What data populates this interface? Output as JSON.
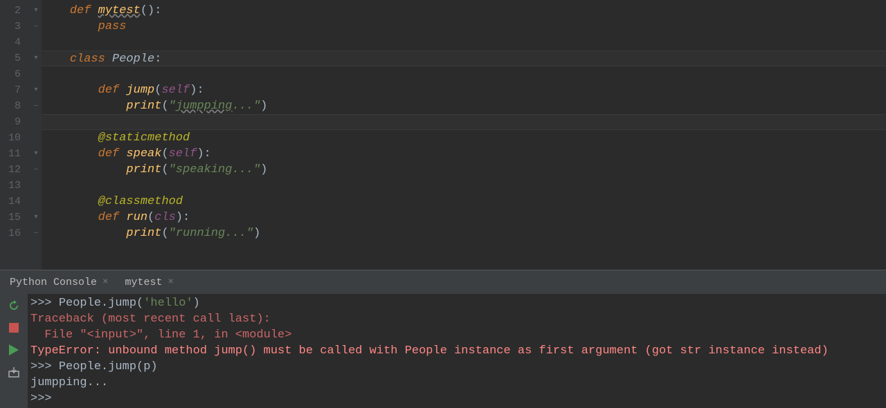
{
  "editor": {
    "lines": [
      {
        "num": 2,
        "fold": "▾",
        "tokens": [
          {
            "t": "kw",
            "v": "def "
          },
          {
            "t": "fn-ul",
            "v": "mytest"
          },
          {
            "t": "punct",
            "v": "():"
          }
        ],
        "indent": 1
      },
      {
        "num": 3,
        "fold": "—",
        "tokens": [
          {
            "t": "kw",
            "v": "pass"
          }
        ],
        "indent": 2
      },
      {
        "num": 4,
        "fold": "",
        "tokens": [],
        "indent": 0
      },
      {
        "num": 5,
        "fold": "▾",
        "tokens": [
          {
            "t": "kw",
            "v": "class "
          },
          {
            "t": "cls",
            "v": "People"
          },
          {
            "t": "punct",
            "v": ":"
          }
        ],
        "indent": 1,
        "hl": true
      },
      {
        "num": 6,
        "fold": "",
        "tokens": [],
        "indent": 0
      },
      {
        "num": 7,
        "fold": "▾",
        "tokens": [
          {
            "t": "kw",
            "v": "def "
          },
          {
            "t": "fn",
            "v": "jump"
          },
          {
            "t": "punct",
            "v": "("
          },
          {
            "t": "self",
            "v": "self"
          },
          {
            "t": "punct",
            "v": "):"
          }
        ],
        "indent": 2
      },
      {
        "num": 8,
        "fold": "—",
        "tokens": [
          {
            "t": "fn",
            "v": "print"
          },
          {
            "t": "punct",
            "v": "("
          },
          {
            "t": "str",
            "v": "\""
          },
          {
            "t": "str-ul",
            "v": "jumpping"
          },
          {
            "t": "str",
            "v": "...\""
          },
          {
            "t": "punct",
            "v": ")"
          }
        ],
        "indent": 3
      },
      {
        "num": 9,
        "fold": "",
        "tokens": [],
        "indent": 0,
        "hl": true
      },
      {
        "num": 10,
        "fold": "",
        "tokens": [
          {
            "t": "deco",
            "v": "@staticmethod"
          }
        ],
        "indent": 2
      },
      {
        "num": 11,
        "fold": "▾",
        "tokens": [
          {
            "t": "kw",
            "v": "def "
          },
          {
            "t": "fn",
            "v": "speak"
          },
          {
            "t": "punct",
            "v": "("
          },
          {
            "t": "self",
            "v": "self"
          },
          {
            "t": "punct",
            "v": "):"
          }
        ],
        "indent": 2
      },
      {
        "num": 12,
        "fold": "—",
        "tokens": [
          {
            "t": "fn",
            "v": "print"
          },
          {
            "t": "punct",
            "v": "("
          },
          {
            "t": "str",
            "v": "\"speaking...\""
          },
          {
            "t": "punct",
            "v": ")"
          }
        ],
        "indent": 3
      },
      {
        "num": 13,
        "fold": "",
        "tokens": [],
        "indent": 0
      },
      {
        "num": 14,
        "fold": "",
        "tokens": [
          {
            "t": "deco",
            "v": "@classmethod"
          }
        ],
        "indent": 2
      },
      {
        "num": 15,
        "fold": "▾",
        "tokens": [
          {
            "t": "kw",
            "v": "def "
          },
          {
            "t": "fn",
            "v": "run"
          },
          {
            "t": "punct",
            "v": "("
          },
          {
            "t": "self",
            "v": "cls"
          },
          {
            "t": "punct",
            "v": "):"
          }
        ],
        "indent": 2
      },
      {
        "num": 16,
        "fold": "—",
        "tokens": [
          {
            "t": "fn",
            "v": "print"
          },
          {
            "t": "punct",
            "v": "("
          },
          {
            "t": "str",
            "v": "\"running...\""
          },
          {
            "t": "punct",
            "v": ")"
          }
        ],
        "indent": 3
      }
    ]
  },
  "tabs": [
    {
      "label": "Python Console"
    },
    {
      "label": "mytest"
    }
  ],
  "toolbar_icons": {
    "rerun": "rerun-icon",
    "stop": "stop-icon",
    "run": "run-icon",
    "export": "export-icon"
  },
  "console": {
    "lines": [
      {
        "spans": [
          {
            "t": "prompt",
            "v": ">>> "
          },
          {
            "t": "input-code",
            "v": "People.jump("
          },
          {
            "t": "console-str",
            "v": "'hello'"
          },
          {
            "t": "input-code",
            "v": ")"
          }
        ]
      },
      {
        "spans": [
          {
            "t": "err",
            "v": "Traceback (most recent call last):"
          }
        ]
      },
      {
        "spans": [
          {
            "t": "err",
            "v": "  File \"<input>\", line 1, in <module>"
          }
        ]
      },
      {
        "spans": [
          {
            "t": "err-b",
            "v": "TypeError: unbound method jump() must be called with People instance as first argument (got str instance instead)"
          }
        ]
      },
      {
        "spans": [
          {
            "t": "prompt",
            "v": ">>> "
          },
          {
            "t": "input-code",
            "v": "People.jump(p)"
          }
        ]
      },
      {
        "spans": [
          {
            "t": "input-code",
            "v": "jumpping..."
          }
        ]
      },
      {
        "spans": [
          {
            "t": "prompt",
            "v": ">>> "
          }
        ]
      }
    ]
  }
}
